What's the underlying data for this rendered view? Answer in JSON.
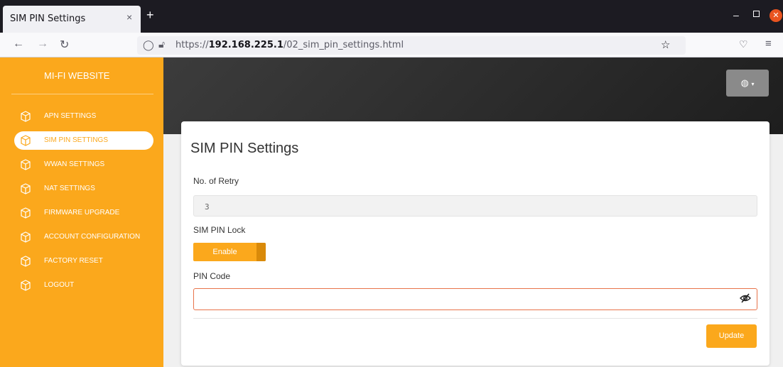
{
  "browser": {
    "tab_title": "SIM PIN Settings",
    "tab_close": "×",
    "new_tab": "+",
    "url_prefix": "https://",
    "url_host": "192.168.225.1",
    "url_path": "/02_sim_pin_settings.html"
  },
  "sidebar": {
    "brand": "MI-FI WEBSITE",
    "items": [
      {
        "label": "APN SETTINGS",
        "active": false
      },
      {
        "label": "SIM PIN SETTINGS",
        "active": true
      },
      {
        "label": "WWAN SETTINGS",
        "active": false
      },
      {
        "label": "NAT SETTINGS",
        "active": false
      },
      {
        "label": "FIRMWARE UPGRADE",
        "active": false
      },
      {
        "label": "ACCOUNT CONFIGURATION",
        "active": false
      },
      {
        "label": "FACTORY RESET",
        "active": false
      },
      {
        "label": "LOGOUT",
        "active": false
      }
    ]
  },
  "header": {
    "language_icon": "globe-icon"
  },
  "form": {
    "title": "SIM PIN Settings",
    "retry_label": "No. of Retry",
    "retry_value": "3",
    "lock_label": "SIM PIN Lock",
    "lock_toggle": "Enable",
    "pin_label": "PIN Code",
    "pin_value": "",
    "update_button": "Update"
  },
  "colors": {
    "accent": "#fba81c",
    "pin_border": "#e8734a",
    "header_dark": "#2a2a2a"
  }
}
